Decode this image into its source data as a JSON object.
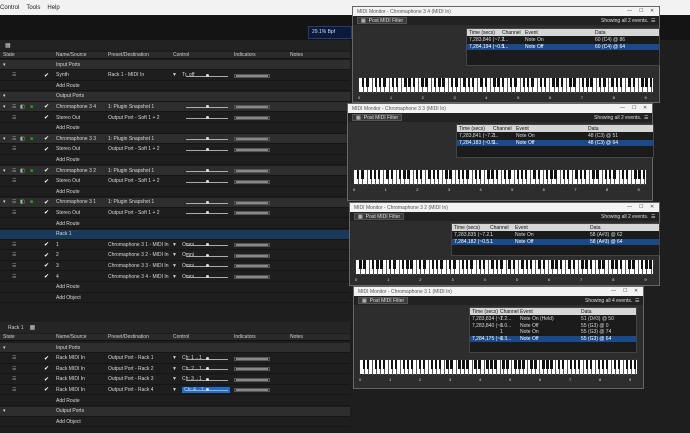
{
  "menu": [
    "Control",
    "Tools",
    "Help"
  ],
  "transport": {
    "cpu": "29.1%",
    "bpm_label": "Bpf"
  },
  "rack_header": {
    "col_state": "State",
    "col_name": "Name/Source",
    "col_preset": "Preset/Destination",
    "col_control": "Control",
    "col_indicators": "Indicators",
    "col_notes": "Notes"
  },
  "rack_rows": [
    {
      "kind": "sec",
      "name": "Input Ports"
    },
    {
      "kind": "norm",
      "name": "Synth",
      "preset": "Rack 1 - MIDI In",
      "control": "Tr. off"
    },
    {
      "kind": "norm",
      "name": "Add Route"
    },
    {
      "kind": "sec",
      "name": "Output Ports"
    },
    {
      "kind": "sec",
      "name": "Chromaphone 3 4",
      "preset": "1: Plugin Snapshot 1"
    },
    {
      "kind": "norm",
      "name": "Stereo Out",
      "preset": "Output Port - Soft 1 + 2"
    },
    {
      "kind": "norm",
      "name": "Add Route"
    },
    {
      "kind": "sec",
      "name": "Chromaphone 3 3",
      "preset": "1: Plugin Snapshot 1"
    },
    {
      "kind": "norm",
      "name": "Stereo Out",
      "preset": "Output Port - Soft 1 + 2"
    },
    {
      "kind": "norm",
      "name": "Add Route"
    },
    {
      "kind": "sec",
      "name": "Chromaphone 3 2",
      "preset": "1: Plugin Snapshot 1"
    },
    {
      "kind": "norm",
      "name": "Stereo Out",
      "preset": "Output Port - Soft 1 + 2"
    },
    {
      "kind": "norm",
      "name": "Add Route"
    },
    {
      "kind": "sec",
      "name": "Chromaphone 3 1",
      "preset": "1: Plugin Snapshot 1"
    },
    {
      "kind": "norm",
      "name": "Stereo Out",
      "preset": "Output Port - Soft 1 + 2"
    },
    {
      "kind": "norm",
      "name": "Add Route"
    },
    {
      "kind": "sel",
      "name": "Rack 1"
    },
    {
      "kind": "norm",
      "name": "1",
      "preset": "Chromaphone 3 1 - MIDI In",
      "control": "Omni"
    },
    {
      "kind": "norm",
      "name": "2",
      "preset": "Chromaphone 3 2 - MIDI In",
      "control": "Omni"
    },
    {
      "kind": "norm",
      "name": "3",
      "preset": "Chromaphone 3 3 - MIDI In",
      "control": "Omni"
    },
    {
      "kind": "norm",
      "name": "4",
      "preset": "Chromaphone 3 4 - MIDI In",
      "control": "Omni"
    },
    {
      "kind": "norm",
      "name": "Add Route"
    },
    {
      "kind": "norm",
      "name": "Add Object"
    }
  ],
  "rack1_panel": {
    "title": "Rack 1"
  },
  "rack1_rows": [
    {
      "kind": "sec",
      "name": "Input Ports"
    },
    {
      "kind": "norm",
      "name": "Rack MIDI In",
      "preset": "Output Port - Rack 1",
      "control": "Ch: 1→1"
    },
    {
      "kind": "norm",
      "name": "Rack MIDI In",
      "preset": "Output Port - Rack 2",
      "control": "Ch: 2→1"
    },
    {
      "kind": "norm",
      "name": "Rack MIDI In",
      "preset": "Output Port - Rack 3",
      "control": "Ch: 3→1"
    },
    {
      "kind": "norm",
      "name": "Rack MIDI In",
      "preset": "Output Port - Rack 4",
      "control": "Ch: 4→1"
    },
    {
      "kind": "norm",
      "name": "Add Route"
    },
    {
      "kind": "sec",
      "name": "Output Ports"
    },
    {
      "kind": "norm",
      "name": "Add Object"
    }
  ],
  "monitors": [
    {
      "title": "MIDI Monitor - Chromaphone 3 4 (MIDI In)",
      "tab": "Post MIDI Filter",
      "showing": "Showing all 2 events.",
      "cols": [
        "Time (secs)",
        "Channel",
        "Event",
        "Data"
      ],
      "rows": [
        [
          "7,283,846 (~7.2...",
          "1",
          "Note On",
          "60 (C4) @ 86"
        ],
        [
          "7,284,194 (~0.5...",
          "1",
          "Note Off",
          "60 (C4) @ 64"
        ]
      ],
      "octaves": [
        "0",
        "1",
        "2",
        "3",
        "4",
        "5",
        "6",
        "7",
        "8",
        "9"
      ]
    },
    {
      "title": "MIDI Monitor - Chromaphone 3 3 (MIDI In)",
      "tab": "Post MIDI Filter",
      "showing": "Showing all 2 events.",
      "cols": [
        "Time (secs)",
        "Channel",
        "Event",
        "Data"
      ],
      "rows": [
        [
          "7,283,841 (~7.2...",
          "1",
          "Note On",
          "48 (C3) @ 51"
        ],
        [
          "7,284,183 (~0.5...",
          "1",
          "Note Off",
          "48 (C3) @ 64"
        ]
      ],
      "octaves": [
        "0",
        "1",
        "2",
        "3",
        "4",
        "5",
        "6",
        "7",
        "8",
        "9"
      ]
    },
    {
      "title": "MIDI Monitor - Chromaphone 3 2 (MIDI In)",
      "tab": "Post MIDI Filter",
      "showing": "Showing all 2 events.",
      "cols": [
        "Time (secs)",
        "Channel",
        "Event",
        "Data"
      ],
      "rows": [
        [
          "7,283,835 (~7.2...",
          "1",
          "Note On",
          "58 (A#3) @ 62"
        ],
        [
          "7,284,182 (~0.5...",
          "1",
          "Note Off",
          "58 (A#3) @ 64"
        ]
      ],
      "octaves": [
        "0",
        "1",
        "2",
        "3",
        "4",
        "5",
        "6",
        "7",
        "8",
        "9"
      ]
    },
    {
      "title": "MIDI Monitor - Chromaphone 3 1 (MIDI In)",
      "tab": "Post MIDI Filter",
      "showing": "Showing all 4 events.",
      "cols": [
        "Time (secs)",
        "Channel",
        "Event",
        "Data"
      ],
      "rows": [
        [
          "7,283,834 (~7.2...",
          "1",
          "Note On (Held)",
          "51 (D#3) @ 50"
        ],
        [
          "7,283,840 (~0.0...",
          "1",
          "Note Off",
          "55 (G3) @ 0"
        ],
        [
          "",
          "1",
          "Note On",
          "55 (G3) @ 74"
        ],
        [
          "7,284,175 (~0.3...",
          "1",
          "Note Off",
          "55 (G3) @ 64"
        ]
      ],
      "octaves": [
        "0",
        "1",
        "2",
        "3",
        "4",
        "5",
        "6",
        "7",
        "8",
        "9"
      ]
    }
  ]
}
